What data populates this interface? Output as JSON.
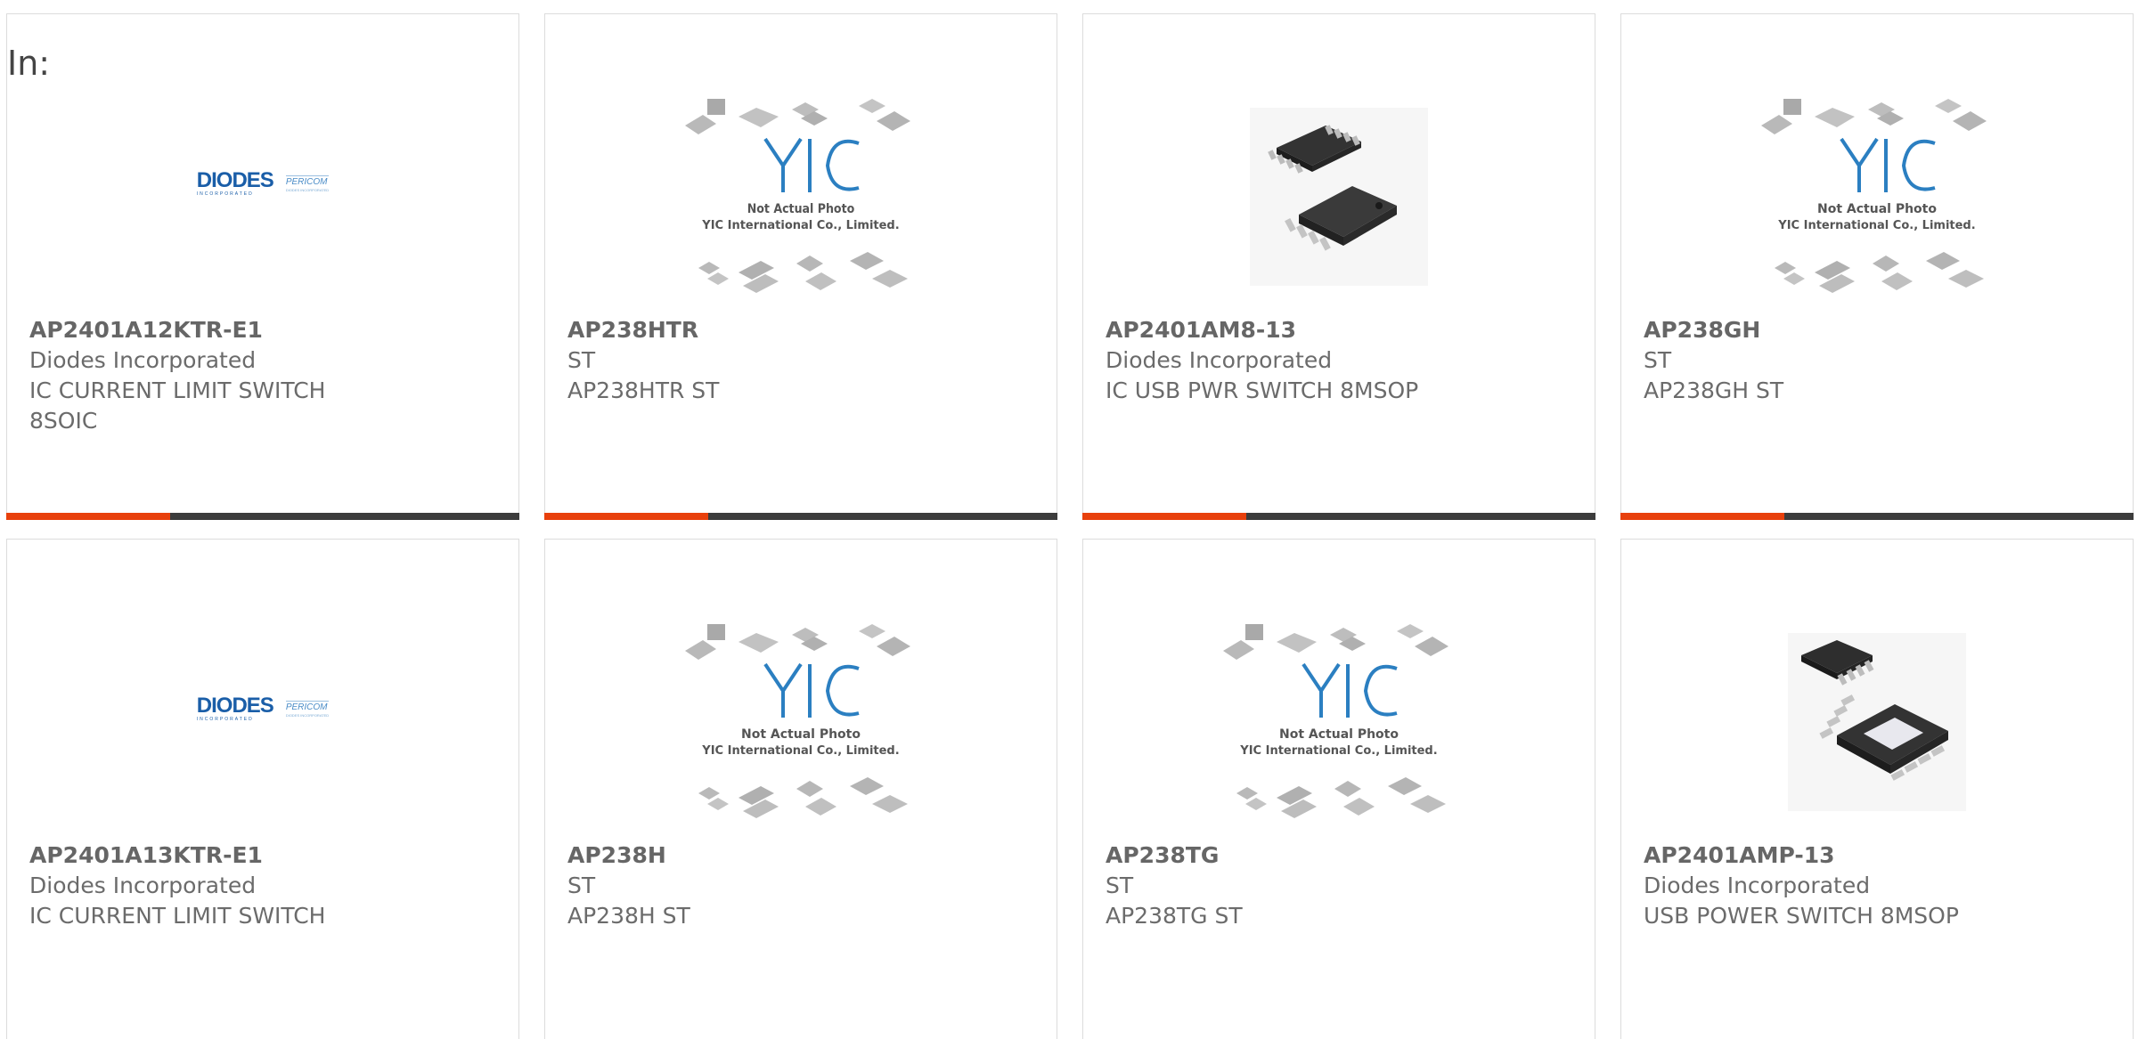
{
  "page": {
    "in_label": "In:"
  },
  "yic": {
    "line1": "Not Actual Photo",
    "line2": "YIC International Co., Limited."
  },
  "diodes_logo": {
    "main": "DIODES",
    "sub": "INCORPORATED",
    "partner": "PERICOM",
    "partner_sub": "DIODES INCORPORATED"
  },
  "products": [
    {
      "part_number": "AP2401A12KTR-E1",
      "manufacturer": "Diodes Incorporated",
      "description": "IC CURRENT LIMIT SWITCH 8SOIC",
      "image": "diodes-logo"
    },
    {
      "part_number": "AP238HTR",
      "manufacturer": "ST",
      "description": "AP238HTR ST",
      "image": "yic-placeholder"
    },
    {
      "part_number": "AP2401AM8-13",
      "manufacturer": "Diodes Incorporated",
      "description": "IC USB PWR SWITCH 8MSOP",
      "image": "msop-chip-photo"
    },
    {
      "part_number": "AP238GH",
      "manufacturer": "ST",
      "description": "AP238GH ST",
      "image": "yic-placeholder"
    },
    {
      "part_number": "AP2401A13KTR-E1",
      "manufacturer": "Diodes Incorporated",
      "description": "IC CURRENT LIMIT SWITCH",
      "image": "diodes-logo"
    },
    {
      "part_number": "AP238H",
      "manufacturer": "ST",
      "description": "AP238H ST",
      "image": "yic-placeholder"
    },
    {
      "part_number": "AP238TG",
      "manufacturer": "ST",
      "description": "AP238TG ST",
      "image": "yic-placeholder"
    },
    {
      "part_number": "AP2401AMP-13",
      "manufacturer": "Diodes Incorporated",
      "description": "USB POWER SWITCH 8MSOP",
      "image": "msop-pad-chip-photo"
    }
  ],
  "colors": {
    "accent": "#e8400c",
    "bar": "#3c3c3c",
    "text": "#6b6b6b",
    "diodes_blue": "#1a5ea8",
    "yic_blue": "#2b7fc1"
  }
}
